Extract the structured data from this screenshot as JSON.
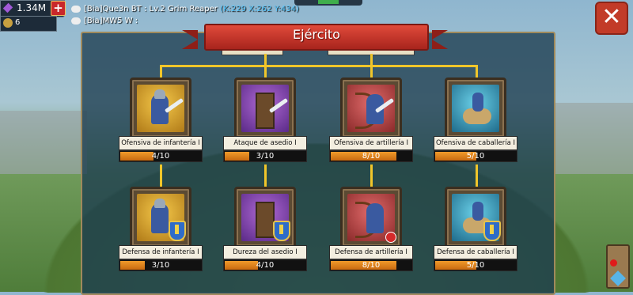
{
  "hud": {
    "gems": "1.34M",
    "plus": "+",
    "level": "6",
    "chat_line1_prefix": "[Bia]Que3n BT : Lv.2 Grim Reaper ",
    "chat_line1_coords": "(K:229 X:262 Y:434)",
    "chat_line2": "[Bia]MW5 W :",
    "close": "✕"
  },
  "panel": {
    "title": "Ejército"
  },
  "skills": [
    {
      "label": "Ofensiva de infantería I",
      "progress": "4/10",
      "ratio": 0.4,
      "type": "inf"
    },
    {
      "label": "Ataque de asedio I",
      "progress": "3/10",
      "ratio": 0.3,
      "type": "sie"
    },
    {
      "label": "Ofensiva de artillería I",
      "progress": "8/10",
      "ratio": 0.8,
      "type": "art"
    },
    {
      "label": "Ofensiva de caballería I",
      "progress": "5/10",
      "ratio": 0.5,
      "type": "cav"
    },
    {
      "label": "Defensa de infantería I",
      "progress": "3/10",
      "ratio": 0.3,
      "type": "inf"
    },
    {
      "label": "Dureza del asedio I",
      "progress": "4/10",
      "ratio": 0.4,
      "type": "sie"
    },
    {
      "label": "Defensa de artillería I",
      "progress": "8/10",
      "ratio": 0.8,
      "type": "art"
    },
    {
      "label": "Defensa de caballería I",
      "progress": "5/10",
      "ratio": 0.5,
      "type": "cav"
    }
  ]
}
